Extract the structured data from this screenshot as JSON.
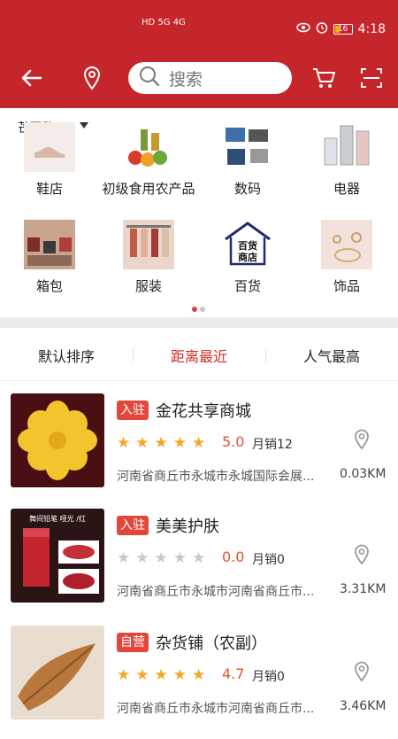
{
  "status": {
    "network_left": "HD 5G 4G",
    "battery": "16",
    "time": "4:18"
  },
  "header": {
    "back_icon": "back-arrow-icon",
    "location_icon": "location-pin-icon",
    "search_placeholder": "搜索",
    "cart_icon": "cart-icon",
    "scan_icon": "scan-icon"
  },
  "location_label": "芒砀路",
  "categories": [
    {
      "label": "鞋店",
      "color": "#e9d7cf"
    },
    {
      "label": "初级食用农产品",
      "color": "#8b9f45"
    },
    {
      "label": "数码",
      "color": "#6f8fb6"
    },
    {
      "label": "电器",
      "color": "#b8c3cc"
    },
    {
      "label": "箱包",
      "color": "#b47b62"
    },
    {
      "label": "服装",
      "color": "#d8b39f"
    },
    {
      "label": "百货",
      "color": "#ffffff"
    },
    {
      "label": "饰品",
      "color": "#f2e0d9"
    }
  ],
  "baihuo_logo_text": "百货商店",
  "sort_tabs": [
    "默认排序",
    "距离最近",
    "人气最高"
  ],
  "stores": [
    {
      "badge": "入驻",
      "name": "金花共享商城",
      "rating": "5.0",
      "stars_on": 5,
      "sales": "月销12",
      "address": "河南省商丘市永城市永城国际会展...",
      "distance": "0.03KM"
    },
    {
      "badge": "入驻",
      "name": "美美护肤",
      "rating": "0.0",
      "stars_on": 0,
      "sales": "月销0",
      "address": "河南省商丘市永城市河南省商丘市...",
      "distance": "3.31KM"
    },
    {
      "badge": "自营",
      "name": "杂货铺（农副）",
      "rating": "4.7",
      "stars_on": 5,
      "sales": "月销0",
      "address": "河南省商丘市永城市河南省商丘市...",
      "distance": "3.46KM"
    }
  ],
  "store_overlay_text": "舞间铅笔 哑光 /红"
}
